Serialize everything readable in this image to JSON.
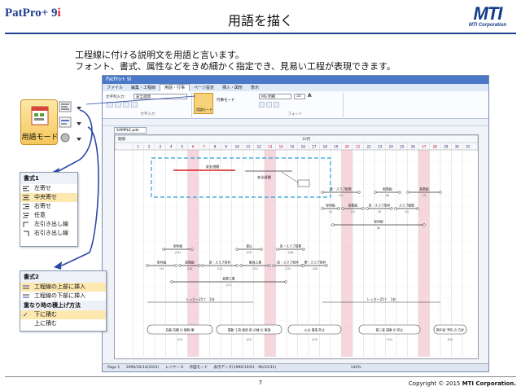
{
  "header": {
    "logo_main": "PatPro+ 9",
    "logo_accent": "i",
    "title": "用語を描く",
    "brand": "MTI",
    "brand_sub": "MTI Corporation"
  },
  "description": {
    "line1": "工程線に付ける説明文を用語と言います。",
    "line2": "フォント、書式、属性などをきめ細かく指定でき、見易い工程が表現できます。"
  },
  "app": {
    "window_title": "PatPro+ 9i",
    "tabs": [
      "ファイル",
      "編集・工程線",
      "用語・行事",
      "ページ設定",
      "挿入・図形",
      "表示"
    ],
    "active_tab": 2,
    "ribbon": {
      "text_input": "文字列入力：",
      "text_value": "安全週間",
      "group1": "文字入力",
      "mode_label": "用語モード",
      "line_label": "行事モード",
      "font_name": "MS 明朝",
      "font_size": "32",
      "group2": "フォント"
    },
    "doc_tab": "SAMPLE.pdx",
    "status": [
      "Page 1",
      "1996/10/14(2024)",
      "レイヤー 0",
      "作図モード",
      "表示データ(1996/10/01 - 96/10/31)",
      "142%"
    ]
  },
  "chart": {
    "period_label": "期間",
    "month": "10月",
    "days": [
      "1",
      "2",
      "3",
      "4",
      "5",
      "6",
      "7",
      "8",
      "9",
      "10",
      "11",
      "12",
      "13",
      "14",
      "15",
      "16",
      "17",
      "18",
      "19",
      "20",
      "21",
      "22",
      "23",
      "24",
      "25",
      "26",
      "27",
      "28",
      "29",
      "30",
      "31"
    ],
    "dashed_labels": [
      "安全週間",
      "安全週間"
    ],
    "task_labels": [
      "型枠組",
      "鉄筋組",
      "床・スラブ型枠",
      "スラブ配筋",
      "床・スラブ配筋",
      "配筋組",
      "鉄筋組",
      "型枠組",
      "型枠組",
      "鉄筋組",
      "床・スラブ型枠",
      "躯体工事",
      "床・スラブ型枠",
      "型枠組",
      "書込",
      "床・スラブ鉄筋",
      "鉄筋工事",
      "壁・スラブ型枠",
      "壁・スラブ型枠",
      "床・型枠",
      "配筋",
      "スラブ配筋",
      "床・スラブ鉄筋",
      "躯体工事"
    ],
    "id_labels": [
      "(1)",
      "(2)",
      "(3)",
      "(4)",
      "(5)",
      "(6)",
      "(7)",
      "(8)",
      "(9)",
      "(10)",
      "(11)",
      "(12)",
      "(13)",
      "(14)",
      "(15)",
      "(16)",
      "(17)",
      "(18)"
    ],
    "crane_labels": [
      "レッカー25ｔ　1台",
      "レッカー25ｔ　1台"
    ],
    "event_labels": [
      "抗菌 抗酸 の 植物 薬",
      "電動 工具 使用 前 点検 の 実施",
      "火災 事故 防止",
      "第三者 損害 の 防止",
      "熱中症 予防 の 方針"
    ],
    "event_ids": [
      "(21)",
      "(22)",
      "(23)",
      "(24)",
      "(25)"
    ]
  },
  "mode_button": {
    "label": "用語モード"
  },
  "format1": {
    "title": "書式1",
    "items": [
      "左寄せ",
      "中央寄せ",
      "右寄せ",
      "任意",
      "左引き出し線",
      "右引き出し線"
    ]
  },
  "format2": {
    "title": "書式2",
    "items": [
      "工程線の上部に挿入",
      "工程線の下部に挿入"
    ],
    "sub_title": "重なり時の積上げ方法",
    "sub_items": [
      "下に積む",
      "上に積む"
    ]
  },
  "footer": {
    "page": "7",
    "copyright": "Copyright © 2015 ",
    "copyright_brand": "MTI Corporation."
  },
  "colors": {
    "accent": "#1f3f8f",
    "red": "#d8201f",
    "holiday": "#f6d5dc",
    "dash": "#2a9fd6"
  }
}
